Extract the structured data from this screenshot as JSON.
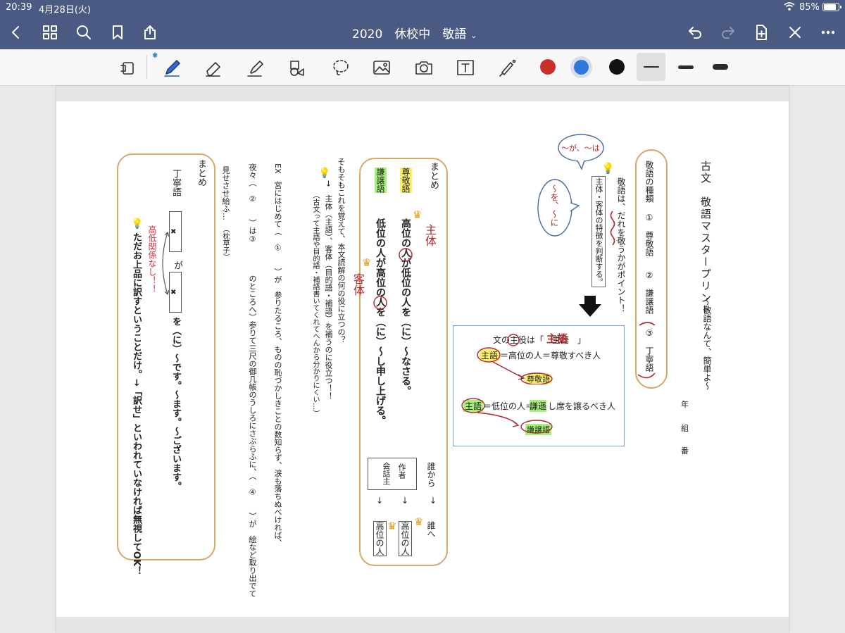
{
  "status": {
    "time": "20:39",
    "date": "4月28日(火)",
    "battery": "85%",
    "battery_level": 0.85
  },
  "nav": {
    "title": "2020　休校中　敬語",
    "icons": [
      "back-icon",
      "grid-icon",
      "search-icon",
      "bookmark-icon",
      "share-icon",
      "undo-icon",
      "redo-icon",
      "add-page-icon",
      "close-icon",
      "more-icon"
    ]
  },
  "toolbar": {
    "tools": [
      "read-mode-icon",
      "pen-icon",
      "eraser-icon",
      "highlighter-icon",
      "shapes-icon",
      "lasso-icon",
      "image-icon",
      "camera-icon",
      "text-icon",
      "laser-icon"
    ],
    "bluetooth": "✱",
    "colors": [
      "#c9302c",
      "#2e78de",
      "#111111"
    ]
  },
  "doc": {
    "title": "古文　敬語マスタープリント",
    "subtitle": "〜敬語なんて、簡単よ〜",
    "year_label": "年",
    "class_label": "組",
    "num_label": "番",
    "kinds_head": "敬語の種類",
    "kinds": [
      "①　尊敬語",
      "②　謙譲語",
      "③　丁寧語"
    ],
    "point_line1": "敬語は、だれを敬うかがポイント！",
    "point_line2": "主体・客体の特徴を判断する。",
    "bubble_top": "〜が、〜は",
    "bubble_side": "〜を、〜に",
    "diag_line1": "文の主役は「　主語　」",
    "diag_subject": "主語",
    "diag_line2a": "主語",
    "diag_line2b": "＝高位の人＝尊敬すべき人",
    "diag_sonkeigo": "尊敬語",
    "diag_line3a": "主語",
    "diag_line3b": "＝低位の人＝",
    "diag_line3c": "謙遜",
    "diag_line3d": "し席を譲るべき人",
    "diag_kenjougo": "謙譲語",
    "matome1": "まとめ",
    "sonkeigo_label": "尊敬語",
    "kenjougo_label": "謙譲語",
    "row1": "高位の人が低位の人を（に）〜なさる。",
    "row2": "低位の人が高位の人を（に）〜し申し上げる。",
    "shutai": "主体",
    "kyakutai": "客体",
    "darekara": "誰から",
    "darehe": "誰へ",
    "writer": "作者",
    "speaker": "会話主",
    "arrow": "↓",
    "koui": "高位の人",
    "q1": "そもそもこれを覚えて、本文読解の何の役に立つの？",
    "q2": "→　主体（主語）、客体（目的語・補語）を補うのに役立つ！！",
    "q3": "（古文って主語や目的語・補語書いてくれてへんから分かりにくい…）",
    "ex1": "EX　宮にはじめて（　①　　）が　参りたるころ、ものの恥づかしきことの数知らず、涙も落ちぬべければ、",
    "ex2": "夜々（　②　　）は③　　　　のところへ）参りて三尺の御几帳のうしろにさぶらふに、（　④　　）が　絵など取り出でて",
    "ex3": "見せさせ給ふ…",
    "ex_source": "（枕草子）",
    "matome2": "まとめ",
    "teineigo": "丁寧語",
    "ga": "が",
    "wo": "を（に）〜です。〜ます。〜ございます。",
    "nohier": "高低関係なし！！",
    "summary": "ただお上品に訳すということだけ。→「訳せ」といわれていなければ無視してOK！",
    "x_mark": "✖"
  }
}
